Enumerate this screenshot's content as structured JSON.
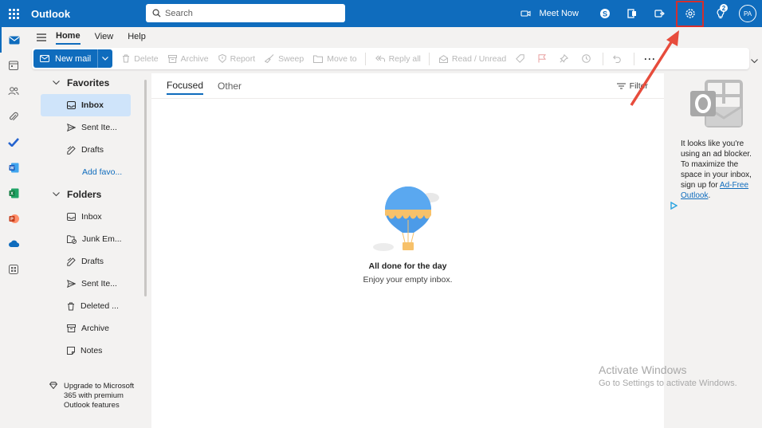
{
  "app": {
    "title": "Outlook"
  },
  "search": {
    "placeholder": "Search"
  },
  "header": {
    "meet_now": "Meet Now",
    "tips_badge": "2",
    "avatar_initials": "PA"
  },
  "ribbon": {
    "tabs": [
      {
        "label": "Home",
        "active": true
      },
      {
        "label": "View",
        "active": false
      },
      {
        "label": "Help",
        "active": false
      }
    ],
    "new_mail": "New mail",
    "delete": "Delete",
    "archive": "Archive",
    "report": "Report",
    "sweep": "Sweep",
    "move_to": "Move to",
    "reply_all": "Reply all",
    "read_unread": "Read / Unread",
    "more": "···"
  },
  "folders": {
    "favorites_label": "Favorites",
    "favorites": [
      {
        "label": "Inbox",
        "icon": "inbox-icon"
      },
      {
        "label": "Sent Ite...",
        "icon": "send-icon"
      },
      {
        "label": "Drafts",
        "icon": "pencil-icon"
      }
    ],
    "add_favorite": "Add favo...",
    "folders_label": "Folders",
    "items": [
      {
        "label": "Inbox",
        "icon": "inbox-icon"
      },
      {
        "label": "Junk Em...",
        "icon": "junk-icon"
      },
      {
        "label": "Drafts",
        "icon": "pencil-icon"
      },
      {
        "label": "Sent Ite...",
        "icon": "send-icon"
      },
      {
        "label": "Deleted ...",
        "icon": "trash-icon"
      },
      {
        "label": "Archive",
        "icon": "archive-icon"
      },
      {
        "label": "Notes",
        "icon": "note-icon"
      }
    ],
    "upgrade": "Upgrade to Microsoft 365 with premium Outlook features"
  },
  "message_list": {
    "tabs": [
      {
        "label": "Focused",
        "active": true
      },
      {
        "label": "Other",
        "active": false
      }
    ],
    "filter": "Filter",
    "empty_title": "All done for the day",
    "empty_subtitle": "Enjoy your empty inbox."
  },
  "ad": {
    "text": "It looks like you're using an ad blocker. To maximize the space in your inbox, sign up for ",
    "link": "Ad-Free Outlook",
    "suffix": "."
  },
  "watermark": {
    "line1": "Activate Windows",
    "line2": "Go to Settings to activate Windows."
  },
  "colors": {
    "brand": "#0f6cbd",
    "selected": "#cfe4fa",
    "highlight": "#d32f2f"
  }
}
